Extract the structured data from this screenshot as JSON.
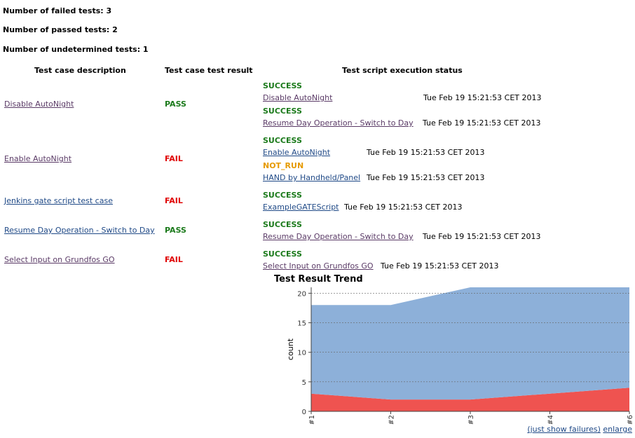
{
  "summary": {
    "failed": "Number of failed tests: 3",
    "passed": "Number of passed tests: 2",
    "undetermined": "Number of undetermined tests: 1"
  },
  "headers": {
    "description": "Test case description",
    "result": "Test case test result",
    "status": "Test script execution status"
  },
  "rows": [
    {
      "description": "Disable AutoNight",
      "result": "PASS",
      "scripts": [
        {
          "status": "SUCCESS",
          "name": "Disable AutoNight",
          "time": "Tue Feb 19 15:21:53 CET 2013"
        },
        {
          "status": "SUCCESS",
          "name": "Resume Day Operation - Switch to Day",
          "time": "Tue Feb 19 15:21:53 CET 2013"
        }
      ]
    },
    {
      "description": "Enable AutoNight",
      "result": "FAIL",
      "scripts": [
        {
          "status": "SUCCESS",
          "name": "Enable AutoNight",
          "time": "Tue Feb 19 15:21:53 CET 2013"
        },
        {
          "status": "NOT_RUN",
          "name": "HAND by Handheld/Panel",
          "time": "Tue Feb 19 15:21:53 CET 2013"
        }
      ]
    },
    {
      "description": "Jenkins gate script test case",
      "result": "FAIL",
      "scripts": [
        {
          "status": "SUCCESS",
          "name": "ExampleGATEScript",
          "time": "Tue Feb 19 15:21:53 CET 2013"
        }
      ]
    },
    {
      "description": "Resume Day Operation - Switch to Day",
      "result": "PASS",
      "scripts": [
        {
          "status": "SUCCESS",
          "name": "Resume Day Operation - Switch to Day",
          "time": "Tue Feb 19 15:21:53 CET 2013"
        }
      ]
    },
    {
      "description": "Select Input on Grundfos GO",
      "result": "FAIL",
      "scripts": [
        {
          "status": "SUCCESS",
          "name": "Select Input on Grundfos GO",
          "time": "Tue Feb 19 15:21:53 CET 2013"
        }
      ]
    }
  ],
  "chart_links": {
    "failures": "(just show failures)",
    "enlarge": "enlarge"
  },
  "chart_data": {
    "type": "area",
    "title": "Test Result Trend",
    "xlabel": "",
    "ylabel": "count",
    "x": [
      "#1",
      "#2",
      "#3",
      "#4",
      "#6"
    ],
    "ylim": [
      0,
      21
    ],
    "yticks": [
      0,
      5,
      10,
      15,
      20
    ],
    "grid": true,
    "legend": "none",
    "series": [
      {
        "name": "",
        "color": "#ef5350",
        "values": [
          3,
          2,
          2,
          3,
          4
        ]
      },
      {
        "name": "",
        "color": "#8db0d9",
        "values": [
          15,
          16,
          19,
          18,
          17
        ]
      }
    ]
  }
}
